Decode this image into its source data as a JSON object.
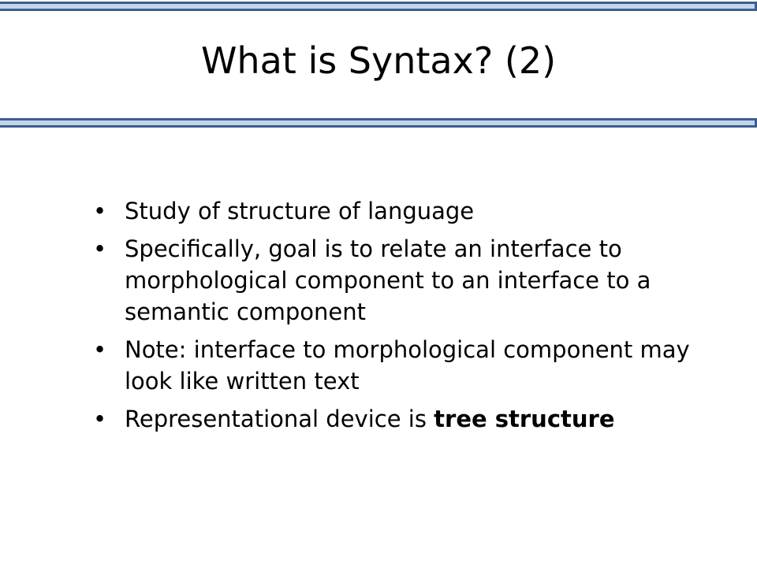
{
  "slide": {
    "title": "What is Syntax? (2)",
    "bullet_symbol": "•",
    "bullets": [
      {
        "text": "Study of structure of language"
      },
      {
        "text": "Specifically, goal is to relate an interface to morphological component to an interface to a semantic component"
      },
      {
        "text": "Note: interface to morphological component may look like written text"
      },
      {
        "text": "Representational device is ",
        "bold": "tree structure"
      }
    ]
  },
  "colors": {
    "bar_fill": "#c6d4ea",
    "bar_border": "#3b5e8f"
  }
}
